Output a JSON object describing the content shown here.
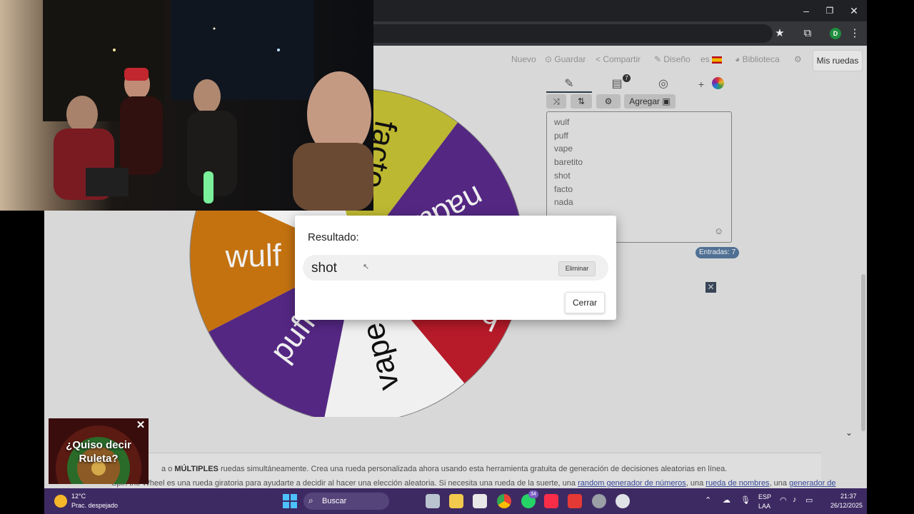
{
  "browser": {
    "minimize": "–",
    "maximize": "❐",
    "close": "✕",
    "profile_initial": "D"
  },
  "menu": {
    "nuevo": "Nuevo",
    "guardar": "Guardar",
    "compartir": "Compartir",
    "diseno": "Diseño",
    "lang": "es",
    "biblioteca": "Biblioteca",
    "mis_ruedas": "Mis ruedas"
  },
  "tabs": {
    "badge": "7"
  },
  "toolbar": {
    "agregar": "Agregar"
  },
  "entries": [
    "wulf",
    "puff",
    "vape",
    "baretito",
    "shot",
    "facto",
    "nada"
  ],
  "entries_count": "Entradas: 7",
  "wheel": {
    "segments": [
      {
        "label": "facto",
        "color": "#c9c435"
      },
      {
        "label": "nada",
        "color": "#5a2a8c"
      },
      {
        "label": "baretito",
        "color": "#c31c2c"
      },
      {
        "label": "vape",
        "color": "#ffffff"
      },
      {
        "label": "puff",
        "color": "#5a2a8c"
      },
      {
        "label": "wulf",
        "color": "#d17a12"
      },
      {
        "label": "shot",
        "color": "#ffffff"
      }
    ]
  },
  "modal": {
    "title": "Resultado:",
    "result": "shot",
    "eliminar": "Eliminar",
    "cerrar": "Cerrar"
  },
  "article": {
    "line1_pre": "a o",
    "line1_bold": "MÚLTIPLES",
    "line1_post": "ruedas simultáneamente. Crea una rueda personalizada ahora usando esta herramienta gratuita de generación de decisiones aleatorias en línea.",
    "line2_pre": "Spin the Wheel es una rueda giratoria para ayudarte a decidir al hacer una elección aleatoria. Si necesita una rueda de la suerte, una",
    "link1": "random generador de números",
    "line2_mid": ", una",
    "link2": "rueda de nombres",
    "line2_post": ", una",
    "link3": "generador de"
  },
  "popup": {
    "line1": "¿Quiso decir",
    "line2": "Ruleta?"
  },
  "taskbar": {
    "temp": "12°C",
    "weather": "Prac. despejado",
    "search": "Buscar",
    "whatsapp_badge": "34",
    "lang1": "ESP",
    "lang2": "LAA",
    "time": "21:37",
    "date": "26/12/2025"
  }
}
